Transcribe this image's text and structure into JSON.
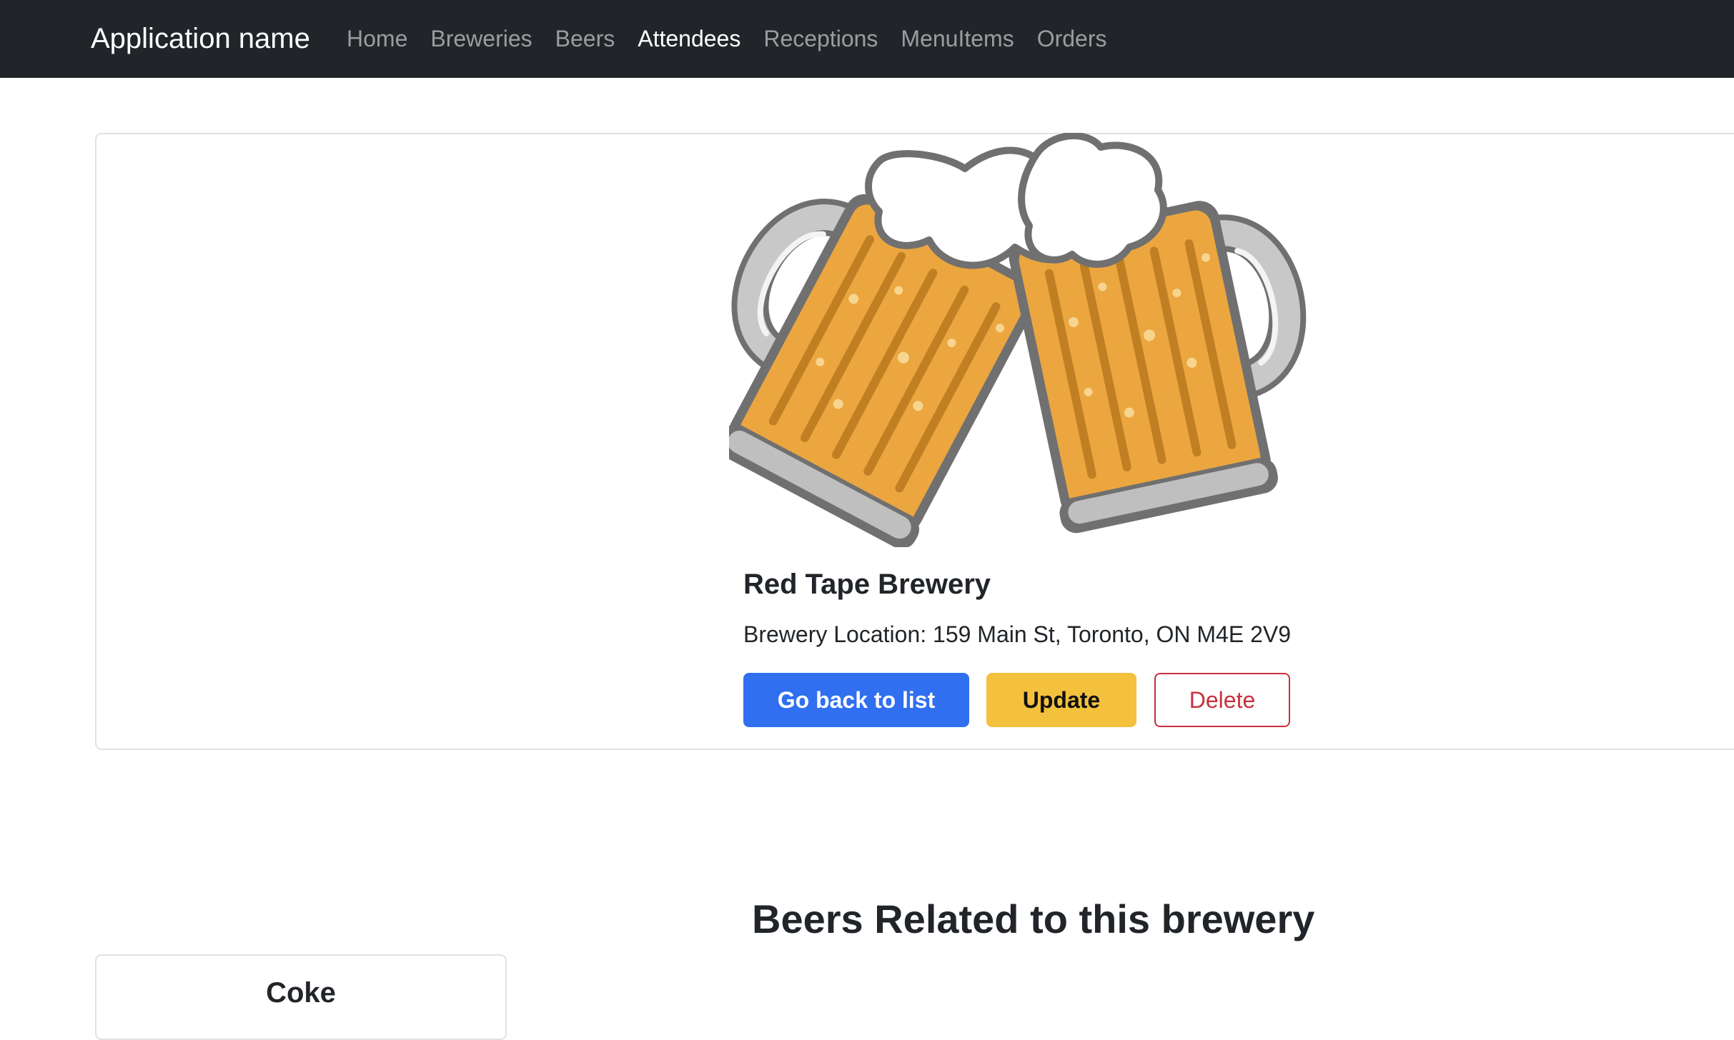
{
  "navbar": {
    "brand": "Application name",
    "links": [
      {
        "label": "Home"
      },
      {
        "label": "Breweries"
      },
      {
        "label": "Beers"
      },
      {
        "label": "Attendees"
      },
      {
        "label": "Receptions"
      },
      {
        "label": "MenuItems"
      },
      {
        "label": "Orders"
      }
    ],
    "active_link": "Attendees"
  },
  "brewery": {
    "image_alt": "two-beer-mugs-cheers-icon",
    "name": "Red Tape Brewery",
    "location": "Brewery Location: 159 Main St, Toronto, ON M4E 2V9",
    "buttons": {
      "back": "Go back to list",
      "update": "Update",
      "delete": "Delete"
    }
  },
  "related": {
    "title": "Beers Related to this brewery",
    "beers": [
      {
        "name": "Coke"
      }
    ]
  },
  "colors": {
    "navbar_bg": "#212529",
    "primary": "#2f6ff0",
    "warning": "#f4c13d",
    "danger": "#c9303e",
    "beer": "#eba640",
    "foam": "#ffffff"
  }
}
